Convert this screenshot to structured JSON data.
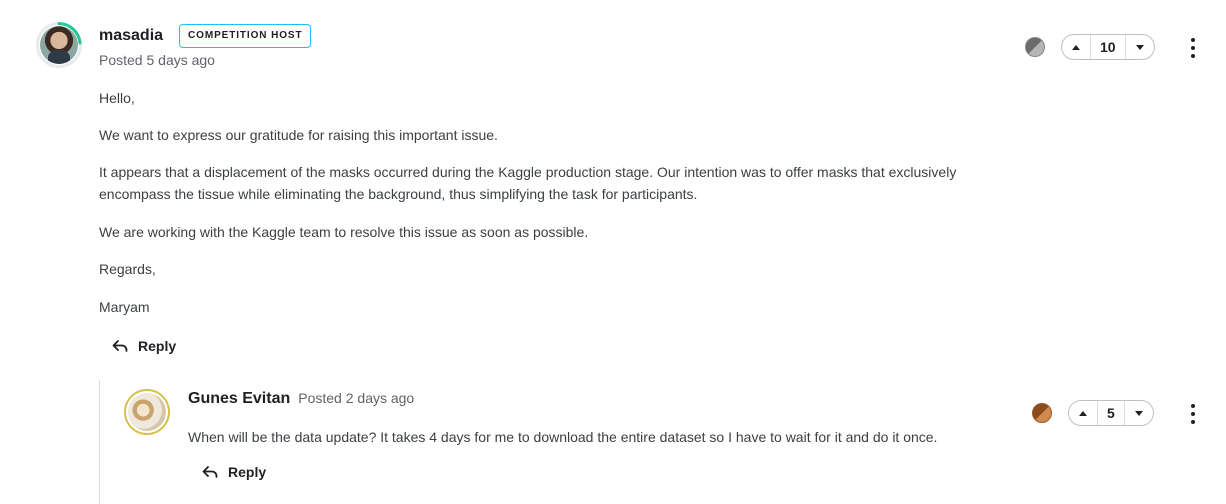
{
  "post": {
    "author": "masadia",
    "badge": "COMPETITION HOST",
    "posted": "Posted 5 days ago",
    "paragraphs": [
      "Hello,",
      "We want to express our gratitude for raising this important issue.",
      "It appears that a displacement of the masks occurred during the Kaggle production stage. Our intention was to offer masks that exclusively encompass the tissue while eliminating the background, thus simplifying the task for participants.",
      "We are working with the Kaggle team to resolve this issue as soon as possible.",
      "Regards,",
      "Maryam"
    ],
    "reply_label": "Reply",
    "votes": "10",
    "medal_color": "#8f8f8f",
    "medal_icon": "silver-medal-icon"
  },
  "comment": {
    "author": "Gunes Evitan",
    "posted": "Posted 2 days ago",
    "text": "When will be the data update? It takes 4 days for me to download the entire dataset so I have to wait for it and do it once.",
    "reply_label": "Reply",
    "votes": "5",
    "medal_color": "#b0672f",
    "medal_icon": "bronze-medal-icon"
  },
  "colors": {
    "accent_badge_border": "#20beff",
    "progress_ring": "#20c997",
    "avatar_ring_gold": "#d9c04a"
  }
}
